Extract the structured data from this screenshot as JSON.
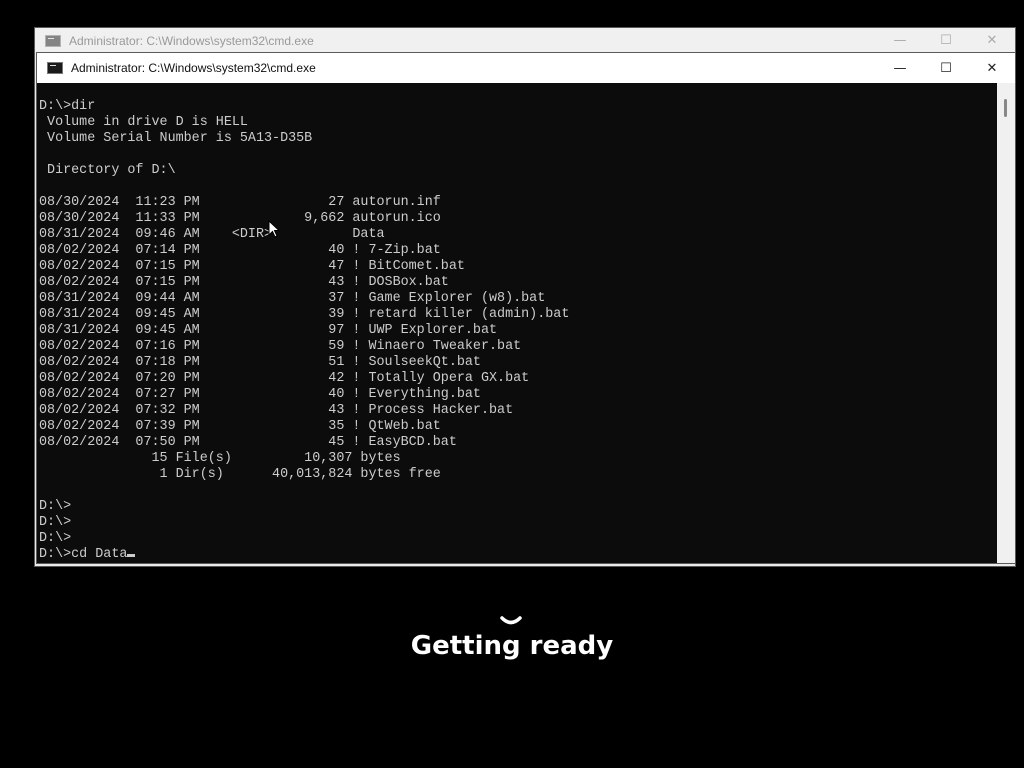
{
  "back_window": {
    "title": "Administrator: C:\\Windows\\system32\\cmd.exe",
    "controls": {
      "minimize": "—",
      "maximize": "☐",
      "close": "✕"
    }
  },
  "front_window": {
    "title": "Administrator: C:\\Windows\\system32\\cmd.exe",
    "controls": {
      "minimize": "—",
      "maximize": "☐",
      "close": "✕"
    }
  },
  "console": {
    "lines": [
      "D:\\>dir",
      " Volume in drive D is HELL",
      " Volume Serial Number is 5A13-D35B",
      "",
      " Directory of D:\\",
      "",
      "08/30/2024  11:23 PM                27 autorun.inf",
      "08/30/2024  11:33 PM             9,662 autorun.ico",
      "08/31/2024  09:46 AM    <DIR>          Data",
      "08/02/2024  07:14 PM                40 ! 7-Zip.bat",
      "08/02/2024  07:15 PM                47 ! BitComet.bat",
      "08/02/2024  07:15 PM                43 ! DOSBox.bat",
      "08/31/2024  09:44 AM                37 ! Game Explorer (w8).bat",
      "08/31/2024  09:45 AM                39 ! retard killer (admin).bat",
      "08/31/2024  09:45 AM                97 ! UWP Explorer.bat",
      "08/02/2024  07:16 PM                59 ! Winaero Tweaker.bat",
      "08/02/2024  07:18 PM                51 ! SoulseekQt.bat",
      "08/02/2024  07:20 PM                42 ! Totally Opera GX.bat",
      "08/02/2024  07:27 PM                40 ! Everything.bat",
      "08/02/2024  07:32 PM                43 ! Process Hacker.bat",
      "08/02/2024  07:39 PM                35 ! QtWeb.bat",
      "08/02/2024  07:50 PM                45 ! EasyBCD.bat",
      "              15 File(s)         10,307 bytes",
      "               1 Dir(s)      40,013,824 bytes free",
      "",
      "D:\\>",
      "D:\\>",
      "D:\\>"
    ],
    "prompt_line": "D:\\>cd Data"
  },
  "status": {
    "text": "Getting ready"
  }
}
